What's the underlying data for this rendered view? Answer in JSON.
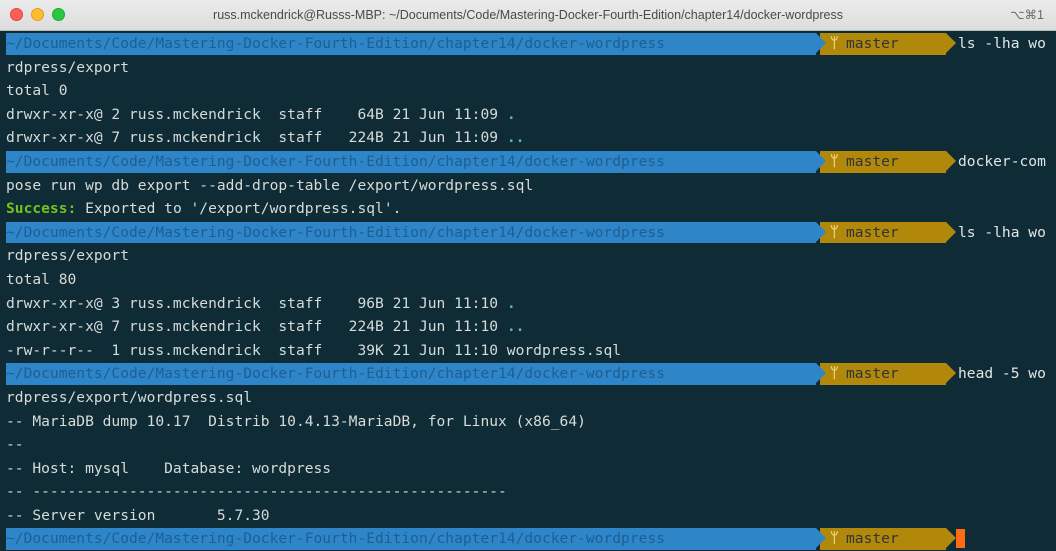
{
  "window": {
    "title": "russ.mckendrick@Russs-MBP: ~/Documents/Code/Mastering-Docker-Fourth-Edition/chapter14/docker-wordpress",
    "shortcut": "⌥⌘1"
  },
  "prompt": {
    "path": "~/Documents/Code/Mastering-Docker-Fourth-Edition/chapter14/docker-wordpress",
    "branch_icon": "ᛘ",
    "branch": "master"
  },
  "commands": [
    "ls -lha wo",
    "docker-com",
    "ls -lha wo",
    "head -5 wo"
  ],
  "output": {
    "l1": "rdpress/export",
    "l2": "total 0",
    "l3a": "drwxr-xr-x@ 2 russ.mckendrick  staff    64B 21 Jun 11:09 ",
    "l3b": ".",
    "l4a": "drwxr-xr-x@ 7 russ.mckendrick  staff   224B 21 Jun 11:09 ",
    "l4b": "..",
    "l6": "pose run wp db export --add-drop-table /export/wordpress.sql",
    "l7a": "Success:",
    "l7b": " Exported to '/export/wordpress.sql'.",
    "l9": "rdpress/export",
    "l10": "total 80",
    "l11a": "drwxr-xr-x@ 3 russ.mckendrick  staff    96B 21 Jun 11:10 ",
    "l11b": ".",
    "l12a": "drwxr-xr-x@ 7 russ.mckendrick  staff   224B 21 Jun 11:10 ",
    "l12b": "..",
    "l13": "-rw-r--r--  1 russ.mckendrick  staff    39K 21 Jun 11:10 wordpress.sql",
    "l15": "rdpress/export/wordpress.sql",
    "l16": "-- MariaDB dump 10.17  Distrib 10.4.13-MariaDB, for Linux (x86_64)",
    "l17": "--",
    "l18": "-- Host: mysql    Database: wordpress",
    "l19": "-- ------------------------------------------------------",
    "l20": "-- Server version       5.7.30"
  },
  "colors": {
    "background": "#0f2b36",
    "path_segment": "#2e86c9",
    "git_segment": "#b2880a",
    "success": "#74c31b",
    "cursor": "#ff6a14"
  }
}
